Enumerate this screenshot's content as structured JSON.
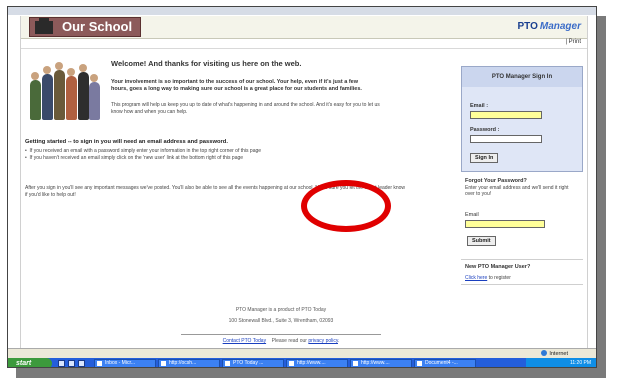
{
  "site": {
    "name": "Our School",
    "logo_main": "PTO",
    "logo_sub": "Manager",
    "print_label": "| Print"
  },
  "main": {
    "welcome": "Welcome! And thanks for visiting us here on the web.",
    "intro_bold": "Your involvement is so important to the success of our school. Your help, even if it's just a few hours, goes a long way to making sure our school is a great place for our students and families.",
    "intro": "This program will help us keep you up to date of what's happening in and around the school. And it's easy for you to let us know how and when you can help.",
    "getting_started": "Getting started -- to sign in you will need an email address and password.",
    "bullets": [
      "If you received an email with a password simply enter your information in the top right corner of this page",
      "If you haven't received an email simply click on the 'new user' link at the bottom right of this page"
    ],
    "after_signin": "After you sign in you'll see any important messages we've posted. You'll also be able to see all the events happening at our school. Make sure you let the event leader know if you'd like to help out!"
  },
  "signin": {
    "title": "PTO Manager Sign In",
    "email_label": "Email :",
    "password_label": "Password :",
    "button": "Sign In"
  },
  "forgot": {
    "title": "Forgot Your Password?",
    "desc": "Enter your email address and we'll send it right over to you!",
    "email_label": "Email",
    "button": "Submit"
  },
  "new_user": {
    "title": "New PTO Manager User?",
    "link": "Click here",
    "suffix": " to register"
  },
  "footer": {
    "line1": "PTO Manager is a product of PTO Today",
    "line2": "100 Stonewall Blvd., Suite 3, Wrentham, 02093",
    "contact_link": "Contact PTO Today",
    "privacy_prefix": "Please read our",
    "privacy_link": "privacy policy"
  },
  "browser": {
    "zone": "Internet"
  },
  "taskbar": {
    "start": "start",
    "tasks": [
      "Inbox - Micr...",
      "http://ocsh...",
      "PTO Today ...",
      "http://www....",
      "http://www....",
      "Document4 -..."
    ],
    "clock": "11:20 PM"
  },
  "colors": {
    "brand": "#8c5a5a",
    "accent": "#1a3f8f",
    "highlight_circle": "#e00000",
    "taskbar": "#245edb"
  }
}
